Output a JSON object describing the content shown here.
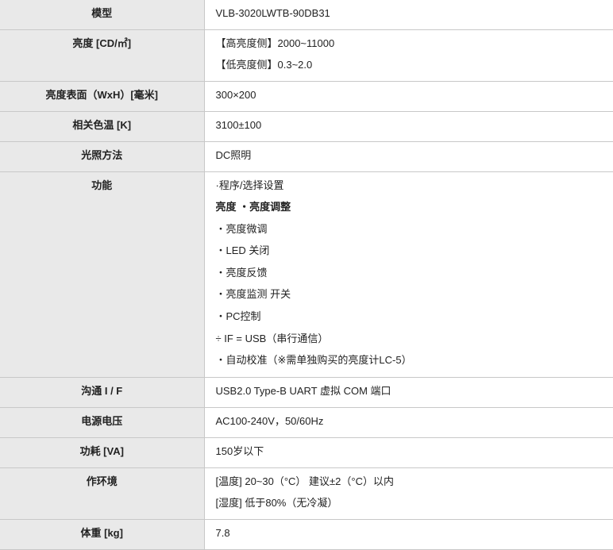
{
  "rows": [
    {
      "key": "模型",
      "lines": [
        "VLB-3020LWTB-90DB31"
      ]
    },
    {
      "key": "亮度 [CD/㎡]",
      "lines": [
        "【高亮度侧】2000~11000",
        "【低亮度侧】0.3~2.0"
      ]
    },
    {
      "key": "亮度表面（WxH）[毫米]",
      "lines": [
        "300×200"
      ]
    },
    {
      "key": "相关色温 [K]",
      "lines": [
        "3100±100"
      ]
    },
    {
      "key": "光照方法",
      "lines": [
        "DC照明"
      ]
    },
    {
      "key": "功能",
      "lines": [
        "·程序/选择设置",
        "亮度 ・亮度调整",
        "・亮度微调",
        "・LED 关闭",
        "・亮度反馈",
        "・亮度监测 开关",
        "・PC控制",
        "÷ IF = USB（串行通信）",
        "・自动校准（※需单独购买的亮度计LC-5）"
      ]
    },
    {
      "key": "沟通 I / F",
      "lines": [
        "USB2.0 Type-B UART 虚拟 COM 端口"
      ]
    },
    {
      "key": "电源电压",
      "lines": [
        "AC100-240V，50/60Hz"
      ]
    },
    {
      "key": "功耗 [VA]",
      "lines": [
        "150岁以下"
      ]
    },
    {
      "key": "作环境",
      "lines": [
        "[温度] 20~30（°C） 建议±2（°C）以内",
        "[湿度] 低于80%（无冷凝）"
      ]
    },
    {
      "key": "体重 [kg]",
      "lines": [
        "7.8"
      ]
    }
  ]
}
